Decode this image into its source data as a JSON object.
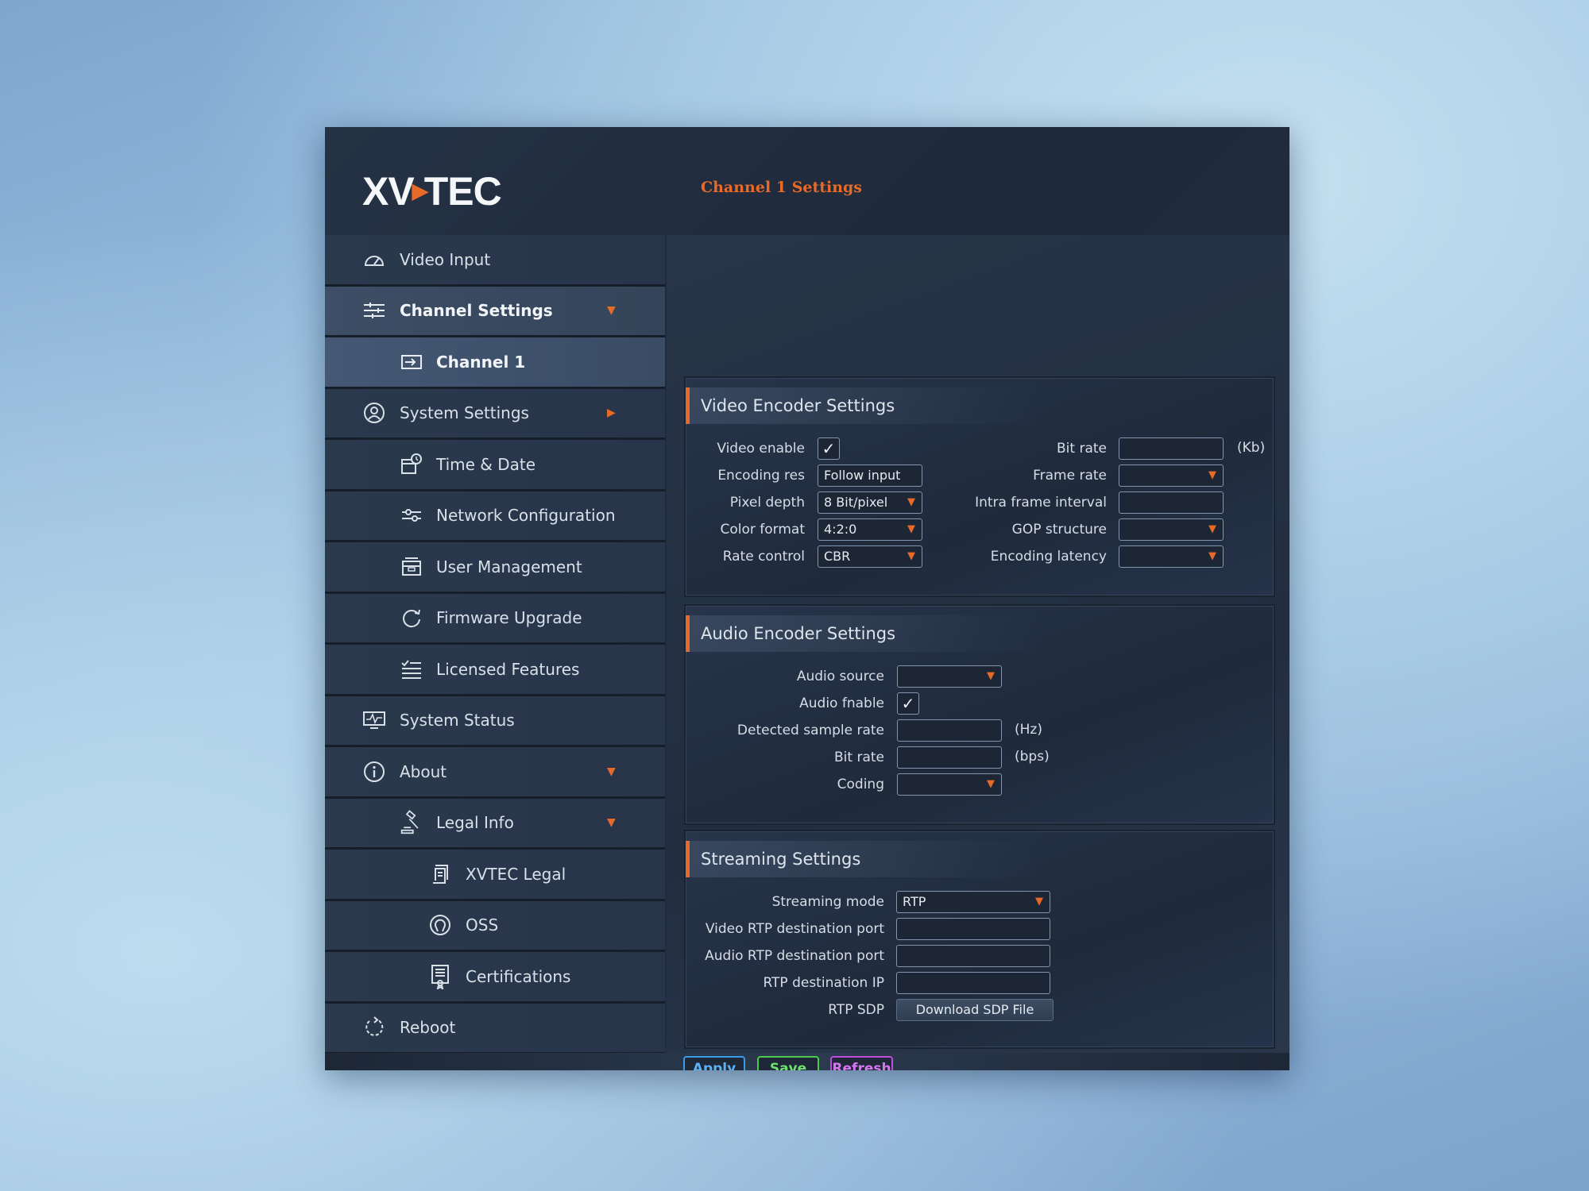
{
  "header": {
    "logo_text": "XVTEC",
    "page_title": "Channel 1 Settings"
  },
  "sidebar": {
    "items": [
      {
        "label": "Video Input",
        "icon": "gauge-icon"
      },
      {
        "label": "Channel Settings",
        "icon": "sliders-icon"
      },
      {
        "label": "Channel 1",
        "icon": "input-icon"
      },
      {
        "label": "System Settings",
        "icon": "user-circle-icon"
      },
      {
        "label": "Time & Date",
        "icon": "calendar-clock-icon"
      },
      {
        "label": "Network Configuration",
        "icon": "network-sliders-icon"
      },
      {
        "label": "User Management",
        "icon": "id-card-icon"
      },
      {
        "label": "Firmware Upgrade",
        "icon": "refresh-icon"
      },
      {
        "label": "Licensed Features",
        "icon": "checklist-icon"
      },
      {
        "label": "System Status",
        "icon": "monitor-pulse-icon"
      },
      {
        "label": "About",
        "icon": "info-icon"
      },
      {
        "label": "Legal Info",
        "icon": "gavel-icon"
      },
      {
        "label": "XVTEC Legal",
        "icon": "scroll-icon"
      },
      {
        "label": "OSS",
        "icon": "open-source-icon"
      },
      {
        "label": "Certifications",
        "icon": "certificate-icon"
      },
      {
        "label": "Reboot",
        "icon": "reboot-icon"
      }
    ]
  },
  "video": {
    "title": "Video Encoder Settings",
    "video_enable_label": "Video enable",
    "video_enable_checked": "✓",
    "encoding_res_label": "Encoding res",
    "encoding_res_value": "Follow input",
    "pixel_depth_label": "Pixel depth",
    "pixel_depth_value": "8 Bit/pixel",
    "color_format_label": "Color format",
    "color_format_value": "4:2:0",
    "rate_control_label": "Rate control",
    "rate_control_value": "CBR",
    "bit_rate_label": "Bit rate",
    "bit_rate_value": "",
    "bit_rate_unit": "(Kb)",
    "frame_rate_label": "Frame rate",
    "frame_rate_value": "",
    "intra_label": "Intra frame interval",
    "intra_value": "",
    "gop_label": "GOP structure",
    "gop_value": "",
    "latency_label": "Encoding latency",
    "latency_value": ""
  },
  "audio": {
    "title": "Audio Encoder Settings",
    "source_label": "Audio source",
    "source_value": "",
    "enable_label": "Audio fnable",
    "enable_checked": "✓",
    "sample_rate_label": "Detected sample rate",
    "sample_rate_value": "",
    "sample_rate_unit": "(Hz)",
    "bit_rate_label": "Bit rate",
    "bit_rate_value": "",
    "bit_rate_unit": "(bps)",
    "coding_label": "Coding",
    "coding_value": ""
  },
  "streaming": {
    "title": "Streaming Settings",
    "mode_label": "Streaming mode",
    "mode_value": "RTP",
    "video_port_label": "Video RTP destination port",
    "video_port_value": "",
    "audio_port_label": "Audio RTP destination port",
    "audio_port_value": "",
    "dest_ip_label": "RTP destination IP",
    "dest_ip_value": "",
    "sdp_label": "RTP SDP",
    "sdp_button": "Download SDP File"
  },
  "actions": {
    "apply": "Apply",
    "save": "Save",
    "refresh": "Refresh"
  },
  "colors": {
    "accent": "#e86a28",
    "apply": "#3b9be8",
    "save": "#4cc94c",
    "refresh": "#c04ce0"
  }
}
